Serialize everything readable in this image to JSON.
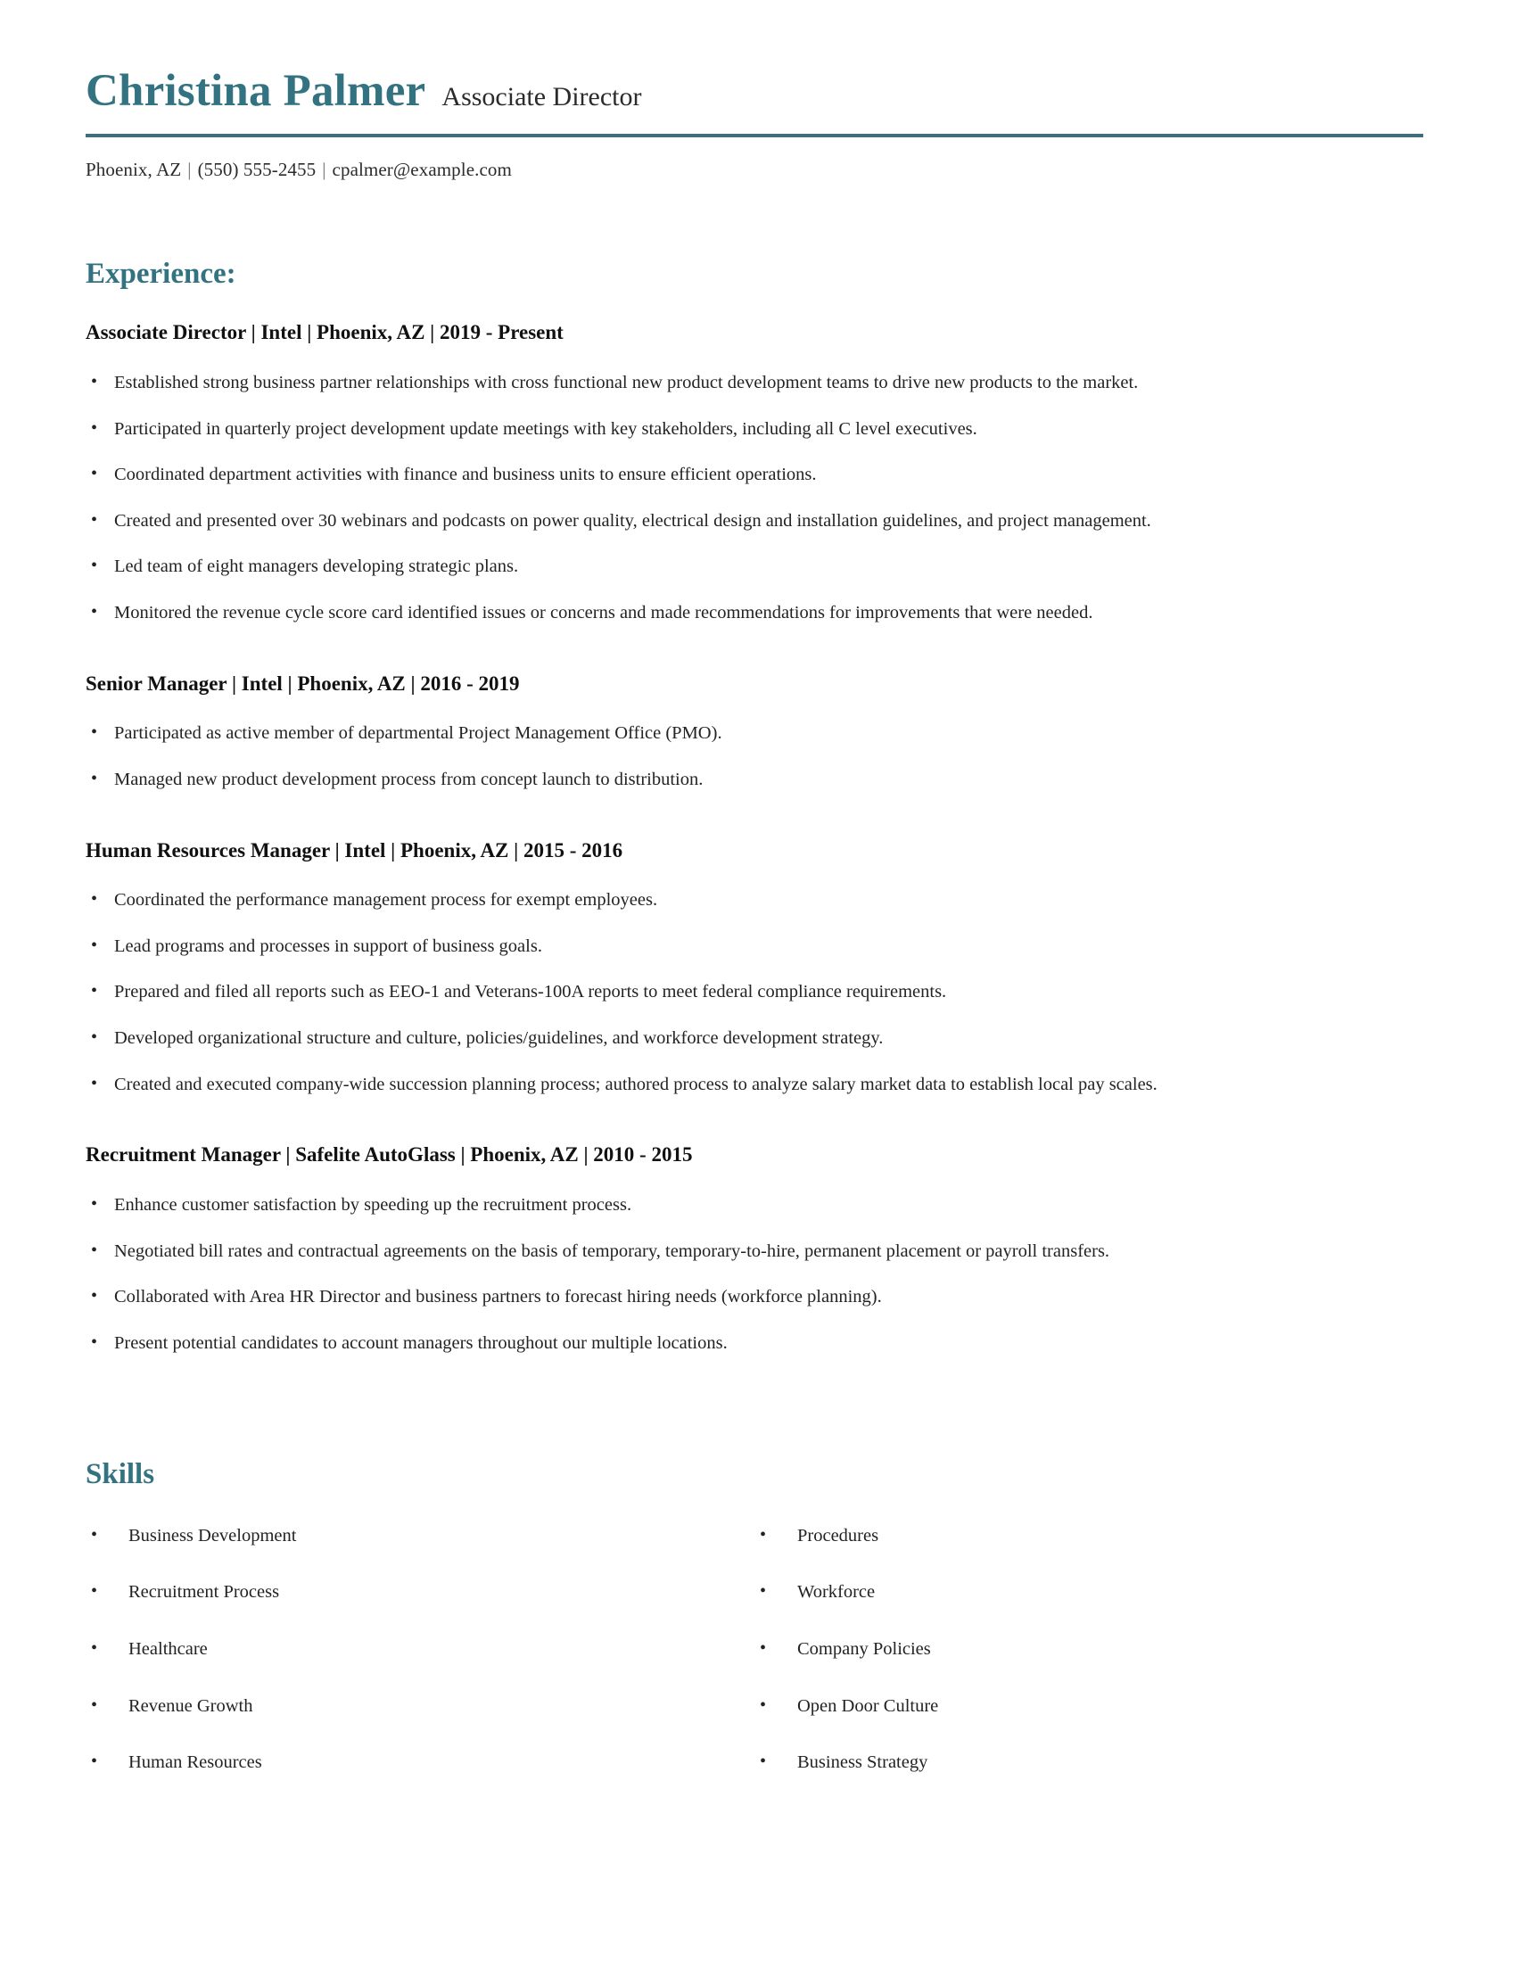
{
  "theme": {
    "accent": "#337381",
    "divider": "#3d6e79",
    "text": "#232323",
    "heading_text": "#111111",
    "background": "#ffffff"
  },
  "header": {
    "name": "Christina Palmer",
    "job_title": "Associate Director",
    "contact": {
      "location": "Phoenix, AZ",
      "separator": "|",
      "phone": "(550) 555-2455",
      "email": "cpalmer@example.com"
    }
  },
  "experience": {
    "heading": "Experience:",
    "jobs": [
      {
        "heading": "Associate Director | Intel | Phoenix, AZ | 2019 - Present",
        "title": "Associate Director",
        "company": "Intel",
        "location": "Phoenix, AZ",
        "dates": "2019 - Present",
        "bullets": [
          "Established strong business partner relationships with cross functional new product development teams to drive new products to the market.",
          "Participated in quarterly project development update meetings with key stakeholders, including all C level executives.",
          "Coordinated department activities with finance and business units to ensure efficient operations.",
          "Created and presented over 30 webinars and podcasts on power quality, electrical design and installation guidelines, and project management.",
          "Led team of eight managers developing strategic plans.",
          "Monitored the revenue cycle score card identified issues or concerns and made recommendations for improvements that were needed."
        ]
      },
      {
        "heading": "Senior Manager | Intel | Phoenix, AZ | 2016 - 2019",
        "title": "Senior Manager",
        "company": "Intel",
        "location": "Phoenix, AZ",
        "dates": "2016 - 2019",
        "bullets": [
          "Participated as active member of departmental Project Management Office (PMO).",
          "Managed new product development process from concept launch to distribution."
        ]
      },
      {
        "heading": "Human Resources Manager | Intel | Phoenix, AZ | 2015 - 2016",
        "title": "Human Resources Manager",
        "company": "Intel",
        "location": "Phoenix, AZ",
        "dates": "2015 - 2016",
        "bullets": [
          "Coordinated the performance management process for exempt employees.",
          "Lead programs and processes in support of business goals.",
          "Prepared and filed all reports such as EEO-1 and Veterans-100A reports to meet federal compliance requirements.",
          "Developed organizational structure and culture, policies/guidelines, and workforce development strategy.",
          "Created and executed company-wide succession planning process; authored process to analyze salary market data to establish local pay scales."
        ]
      },
      {
        "heading": "Recruitment Manager | Safelite AutoGlass | Phoenix, AZ | 2010 - 2015",
        "title": "Recruitment Manager",
        "company": "Safelite AutoGlass",
        "location": "Phoenix, AZ",
        "dates": "2010 - 2015",
        "bullets": [
          "Enhance customer satisfaction by speeding up the recruitment process.",
          "Negotiated bill rates and contractual agreements on the basis of temporary, temporary-to-hire, permanent placement or payroll transfers.",
          "Collaborated with Area HR Director and business partners to forecast hiring needs (workforce planning).",
          "Present potential candidates to account managers throughout our multiple locations."
        ]
      }
    ]
  },
  "skills": {
    "heading": "Skills",
    "column_left": [
      "Business Development",
      "Recruitment Process",
      "Healthcare",
      "Revenue Growth",
      "Human Resources"
    ],
    "column_right": [
      "Procedures",
      "Workforce",
      "Company Policies",
      "Open Door Culture",
      "Business Strategy"
    ]
  }
}
